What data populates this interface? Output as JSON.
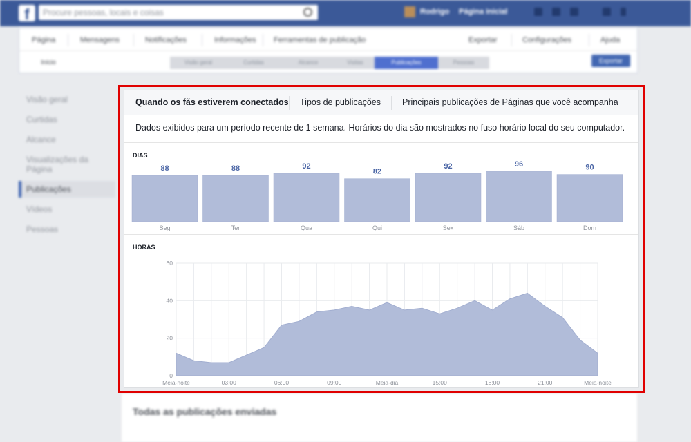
{
  "topbar": {
    "search_placeholder": "Procure pessoas, locais e coisas",
    "user_name": "Rodrigo",
    "home_label": "Página inicial"
  },
  "page_nav": {
    "items": [
      "Página",
      "Mensagens",
      "Notificações",
      "Informações",
      "Ferramentas de publicação"
    ],
    "right_items": [
      "Exportar",
      "Configurações",
      "Ajuda"
    ]
  },
  "subnav": {
    "all_label": "Início",
    "steps": [
      "Visão geral",
      "Curtidas",
      "Alcance",
      "Visitas",
      "Publicações",
      "Pessoas"
    ],
    "active_step": "Publicações",
    "export_label": "Exportar"
  },
  "sidebar": {
    "items": [
      "Visão geral",
      "Curtidas",
      "Alcance",
      "Visualizações da Página",
      "Publicações",
      "Vídeos",
      "Pessoas"
    ],
    "active": "Publicações"
  },
  "panel": {
    "tabs": [
      "Quando os fãs estiverem conectados",
      "Tipos de publicações",
      "Principais publicações de Páginas que você acompanha"
    ],
    "active_tab": "Quando os fãs estiverem conectados",
    "info": "Dados exibidos para um período recente de 1 semana. Horários do dia são mostrados no fuso horário local do seu computador.",
    "days_label": "DIAS",
    "hours_label": "HORAS"
  },
  "bottom": {
    "title": "Todas as publicações enviadas"
  },
  "colors": {
    "facebook_blue": "#3b5998",
    "bar_fill": "#b1bcd9",
    "value_text": "#4a65a5",
    "highlight_border": "#e00000"
  },
  "chart_data": [
    {
      "type": "bar",
      "title": "DIAS",
      "categories": [
        "Seg",
        "Ter",
        "Qua",
        "Qui",
        "Sex",
        "Sáb",
        "Dom"
      ],
      "values": [
        88,
        88,
        92,
        82,
        92,
        96,
        90
      ]
    },
    {
      "type": "area",
      "title": "HORAS",
      "x": [
        0,
        1,
        2,
        3,
        4,
        5,
        6,
        7,
        8,
        9,
        10,
        11,
        12,
        13,
        14,
        15,
        16,
        17,
        18,
        19,
        20,
        21,
        22,
        23,
        24
      ],
      "xtick_labels": [
        "Meia-noite",
        "03:00",
        "06:00",
        "09:00",
        "Meia-dia",
        "15:00",
        "18:00",
        "21:00",
        "Meia-noite"
      ],
      "values": [
        12,
        8,
        7,
        7,
        11,
        15,
        27,
        29,
        34,
        35,
        37,
        35,
        39,
        35,
        36,
        33,
        36,
        40,
        35,
        41,
        44,
        37,
        31,
        19,
        12
      ],
      "ylim": [
        0,
        60
      ],
      "yticks": [
        0,
        20,
        40,
        60
      ],
      "grid": true
    }
  ]
}
